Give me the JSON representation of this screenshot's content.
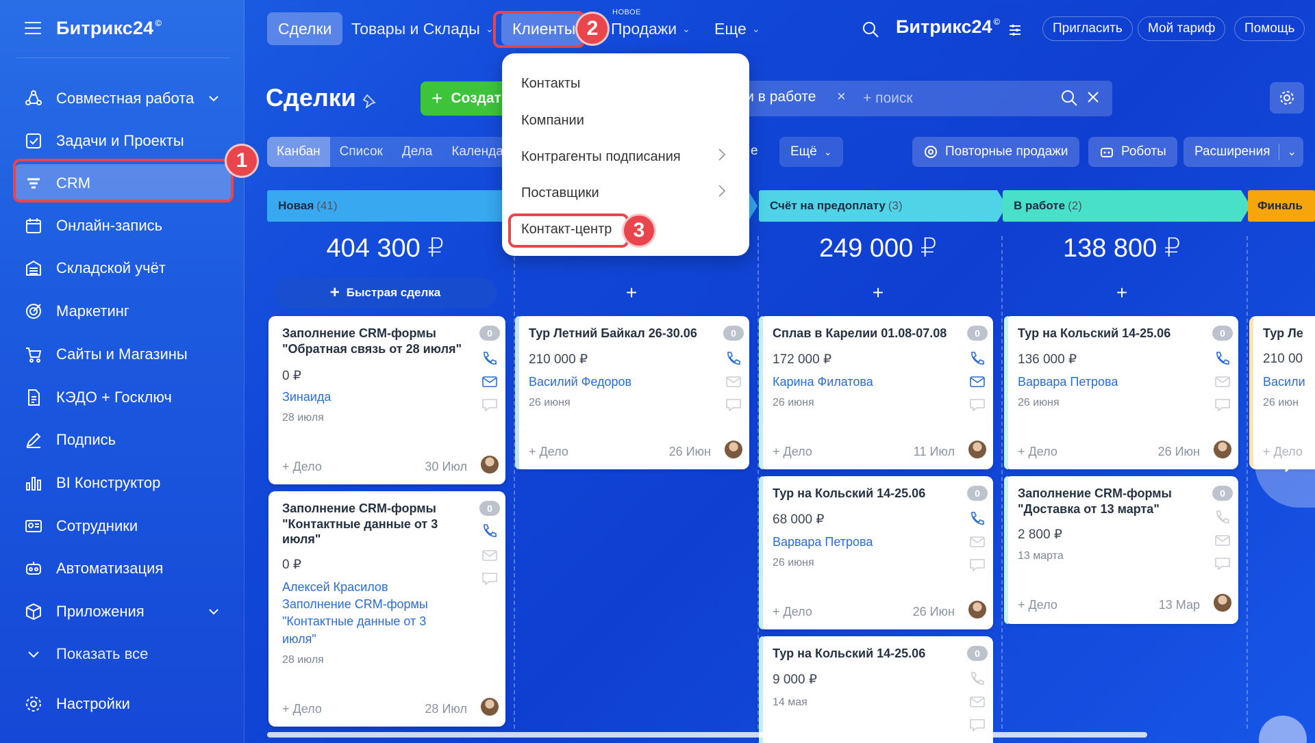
{
  "sidebar": {
    "logo": "Битрикс24",
    "logo_mark": "©",
    "items": [
      {
        "label": "Совместная работа"
      },
      {
        "label": "Задачи и Проекты"
      },
      {
        "label": "CRM"
      },
      {
        "label": "Онлайн-запись"
      },
      {
        "label": "Складской учёт"
      },
      {
        "label": "Маркетинг"
      },
      {
        "label": "Сайты и Магазины"
      },
      {
        "label": "КЭДО + Госключ"
      },
      {
        "label": "Подпись"
      },
      {
        "label": "BI Конструктор"
      },
      {
        "label": "Сотрудники"
      },
      {
        "label": "Автоматизация"
      },
      {
        "label": "Приложения"
      },
      {
        "label": "Показать все"
      },
      {
        "label": "Настройки"
      }
    ]
  },
  "topbar": {
    "tabs": [
      "Сделки",
      "Товары и Склады",
      "Клиенты",
      "Продажи",
      "Еще"
    ],
    "new_tag": "НОВОЕ",
    "right_logo": "Битрикс24",
    "invite": "Пригласить",
    "tariff": "Мой тариф",
    "help": "Помощь"
  },
  "badges": {
    "b1": "1",
    "b2": "2",
    "b3": "3"
  },
  "toolbar": {
    "title": "Сделки",
    "create": "Создать",
    "filter_tag": "ки в работе",
    "search_placeholder": "+ поиск"
  },
  "view_tabs": [
    "Канбан",
    "Список",
    "Дела",
    "Календа"
  ],
  "view_more_prefix": "е",
  "view_more": "Ещё",
  "buttons": {
    "repeat_sales": "Повторные продажи",
    "robots": "Роботы",
    "extensions": "Расширения"
  },
  "menu": {
    "items": [
      "Контакты",
      "Компании",
      "Контрагенты подписания",
      "Поставщики",
      "Контакт-центр"
    ]
  },
  "colors": {
    "new": "#38a9f0",
    "invoice": "#4fd3e6",
    "in_work": "#49e0c8",
    "final": "#f6a50b",
    "badge": "#e8454d"
  },
  "columns": [
    {
      "name": "Новая",
      "count": "(41)",
      "sum": "404 300 ₽",
      "quick": "Быстрая сделка"
    },
    {
      "name": "",
      "count": "",
      "sum": "",
      "add": "+"
    },
    {
      "name": "Счёт на предоплату",
      "count": "(3)",
      "sum": "249 000 ₽",
      "add": "+"
    },
    {
      "name": "В работе",
      "count": "(2)",
      "sum": "138 800 ₽",
      "add": "+"
    },
    {
      "name": "Финаль",
      "count": "",
      "sum": ""
    }
  ],
  "cards": {
    "c1": {
      "title": "Заполнение CRM-формы \"Обратная связь от 28 июля\"",
      "price": "0 ₽",
      "client": "Зинаида",
      "date": "28 июля",
      "delo": "+ Дело",
      "ddate": "30 Июл",
      "zero": "0"
    },
    "c2": {
      "title": "Заполнение CRM-формы \"Контактные данные от 3 июля\"",
      "price": "0 ₽",
      "client": "Алексей Красилов Заполнение CRM-формы \"Контактные данные от 3 июля\"",
      "date": "28 июля",
      "delo": "+ Дело",
      "ddate": "28 Июл",
      "zero": "0"
    },
    "c3": {
      "title": "Тур Летний Байкал 26-30.06",
      "price": "210 000 ₽",
      "client": "Василий Федоров",
      "date": "26 июня",
      "delo": "+ Дело",
      "ddate": "26 Июн",
      "zero": "0"
    },
    "c4": {
      "title": "Сплав в Карелии 01.08-07.08",
      "price": "172 000 ₽",
      "client": "Карина Филатова",
      "date": "26 июня",
      "delo": "+ Дело",
      "ddate": "11 Июл",
      "zero": "0"
    },
    "c5": {
      "title": "Тур на Кольский 14-25.06",
      "price": "68 000 ₽",
      "client": "Варвара Петрова",
      "date": "26 июня",
      "delo": "+ Дело",
      "ddate": "26 Июн",
      "zero": "0"
    },
    "c6": {
      "title": "Тур на Кольский 14-25.06",
      "price": "9 000 ₽",
      "date": "14 мая",
      "zero": "0"
    },
    "c7": {
      "title": "Тур на Кольский 14-25.06",
      "price": "136 000 ₽",
      "client": "Варвара Петрова",
      "date": "26 июня",
      "delo": "+ Дело",
      "ddate": "26 Июн",
      "zero": "0"
    },
    "c8": {
      "title": "Заполнение CRM-формы \"Доставка от 13 марта\"",
      "price": "2 800 ₽",
      "date": "13 марта",
      "delo": "+ Дело",
      "ddate": "13 Мар",
      "zero": "0"
    },
    "c9": {
      "title": "Тур Ле",
      "price": "210 00",
      "client": "Васили",
      "date": "26 июн",
      "delo": "+ Дело"
    }
  }
}
